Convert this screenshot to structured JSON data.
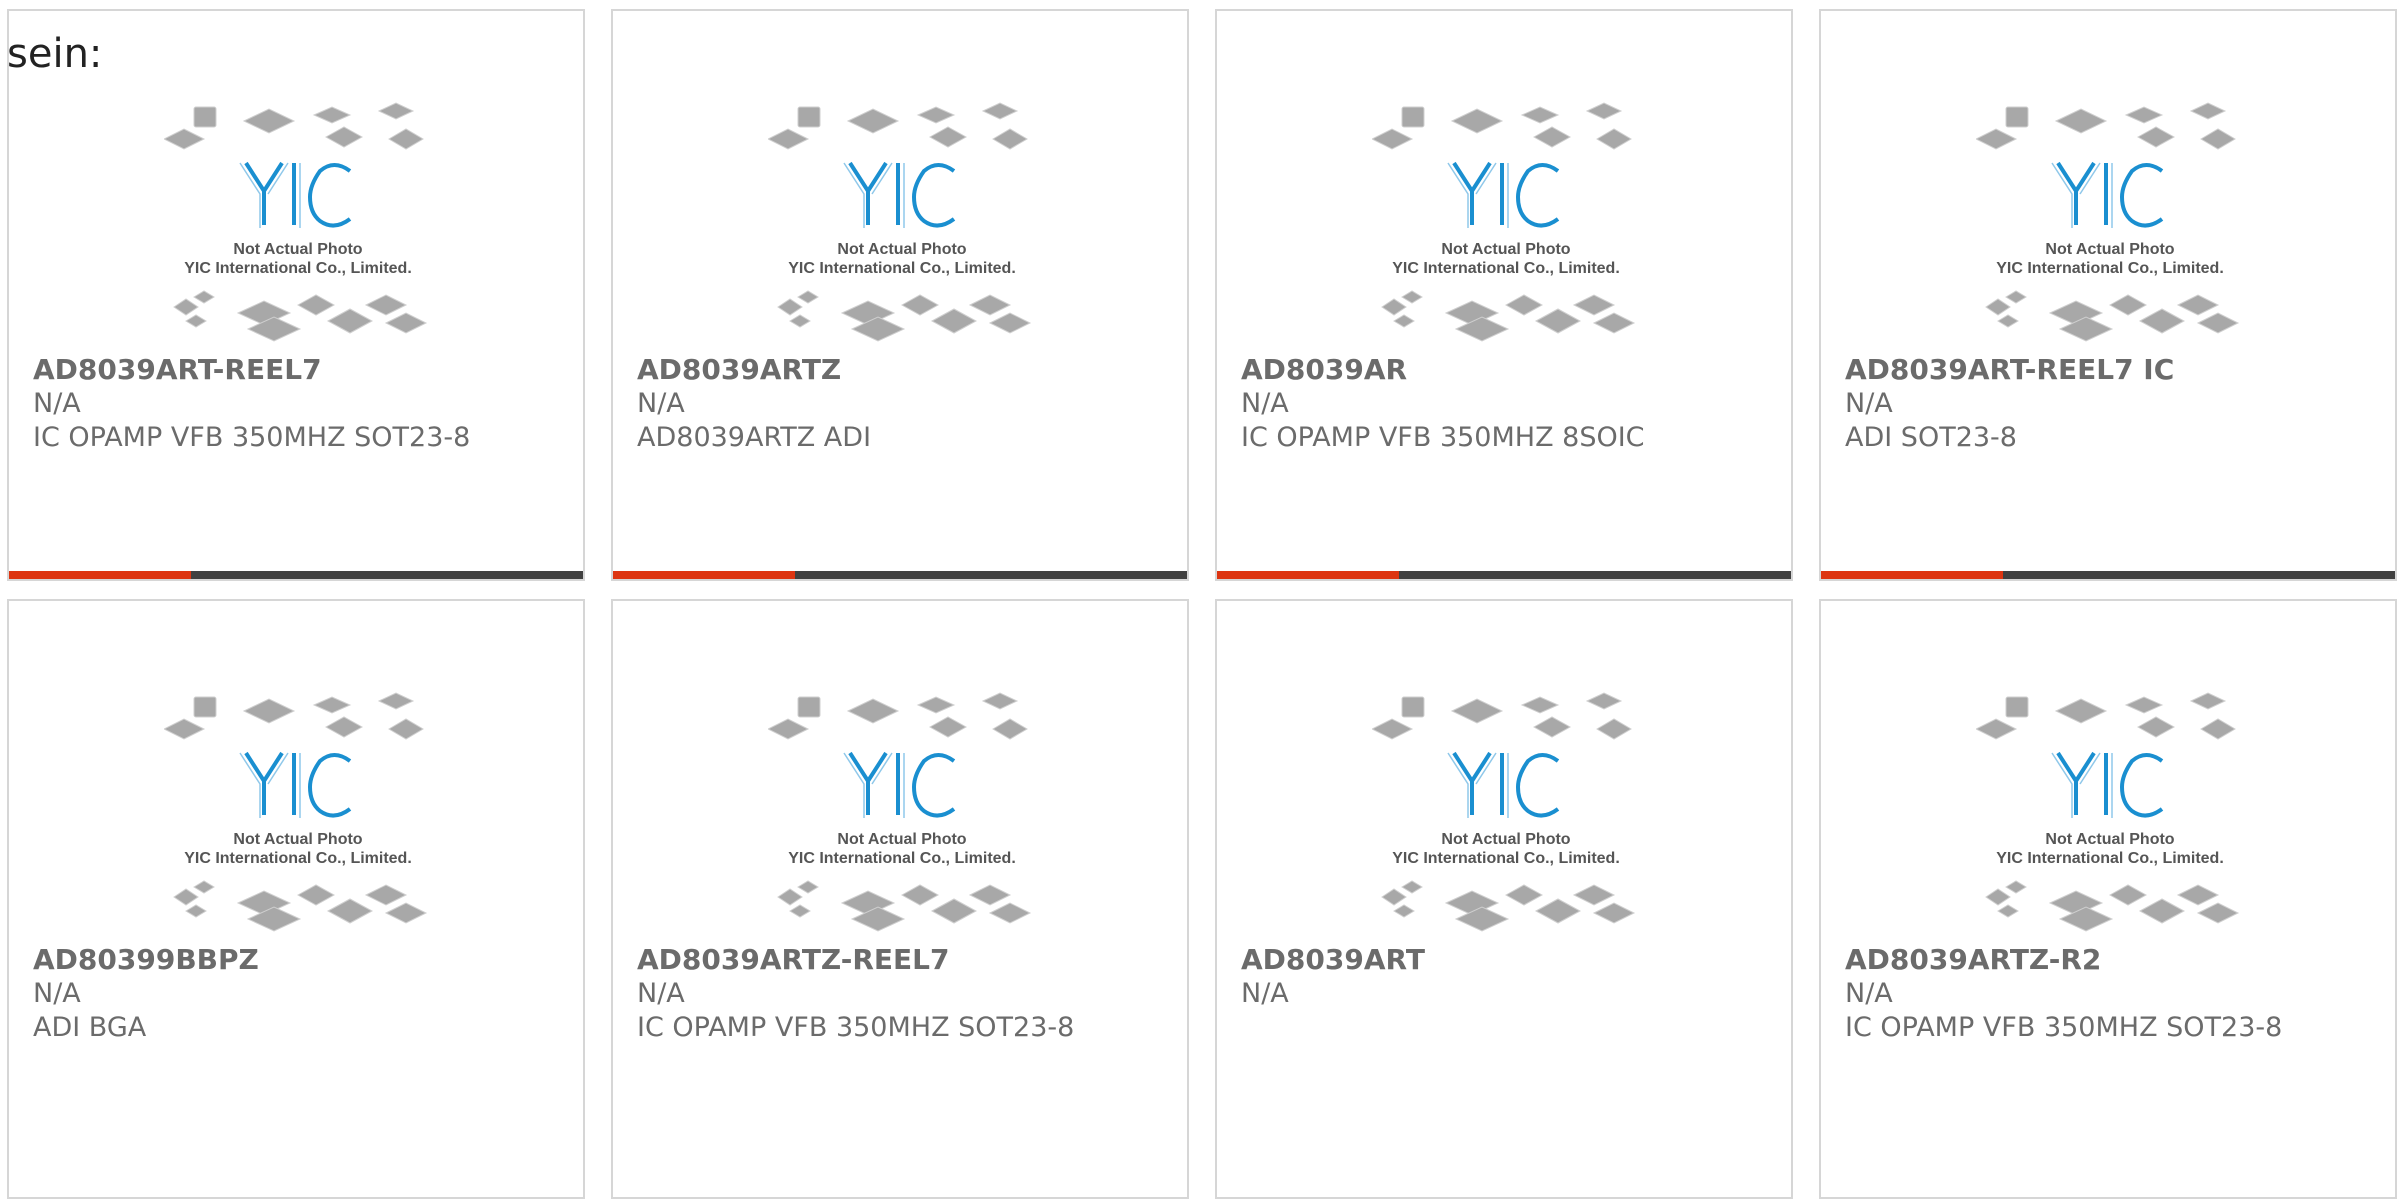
{
  "header": {
    "text": "sein:"
  },
  "photo": {
    "logo": "YIC",
    "line1": "Not Actual Photo",
    "line2": "YIC International Co., Limited."
  },
  "colors": {
    "accent": "#dd3511",
    "bar": "#404040",
    "border": "#d6d6d6",
    "text": "#6b6b6b",
    "logo_blue": "#1a8fd0",
    "chip_gray": "#aaaaaa"
  },
  "products": [
    {
      "part": "AD8039ART-REEL7",
      "mfr": "N/A",
      "desc": "IC OPAMP VFB 350MHZ SOT23-8"
    },
    {
      "part": "AD8039ARTZ",
      "mfr": "N/A",
      "desc": "AD8039ARTZ ADI"
    },
    {
      "part": "AD8039AR",
      "mfr": "N/A",
      "desc": "IC OPAMP VFB 350MHZ 8SOIC"
    },
    {
      "part": "AD8039ART-REEL7 IC",
      "mfr": "N/A",
      "desc": "ADI SOT23-8"
    },
    {
      "part": "AD80399BBPZ",
      "mfr": "N/A",
      "desc": "ADI BGA"
    },
    {
      "part": "AD8039ARTZ-REEL7",
      "mfr": "N/A",
      "desc": "IC OPAMP VFB 350MHZ SOT23-8"
    },
    {
      "part": "AD8039ART",
      "mfr": "N/A",
      "desc": ""
    },
    {
      "part": "AD8039ARTZ-R2",
      "mfr": "N/A",
      "desc": "IC OPAMP VFB 350MHZ SOT23-8"
    }
  ]
}
